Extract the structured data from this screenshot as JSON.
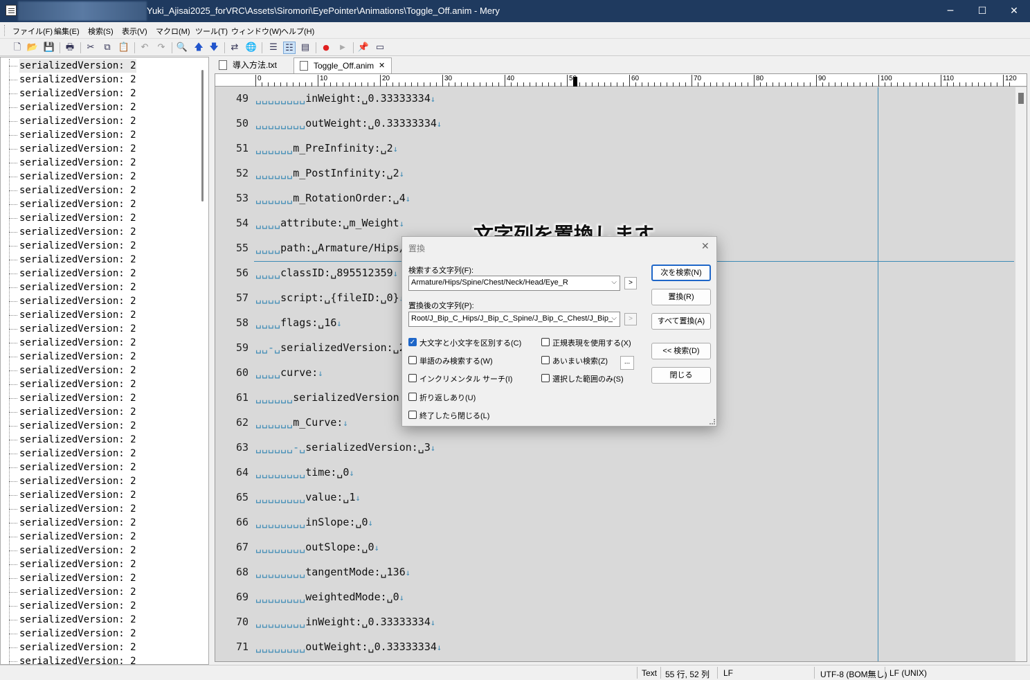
{
  "window": {
    "title": "Yuki_Ajisai2025_forVRC\\Assets\\Siromori\\EyePointer\\Animations\\Toggle_Off.anim - Mery",
    "minimize": "─",
    "maximize": "☐",
    "close": "✕"
  },
  "menu": [
    "ファイル(F)",
    "編集(E)",
    "検索(S)",
    "表示(V)",
    "マクロ(M)",
    "ツール(T)",
    "ウィンドウ(W)",
    "ヘルプ(H)"
  ],
  "toolbar": {
    "icons": [
      "new-file-icon",
      "open-folder-icon",
      "save-icon",
      "print-icon",
      "cut-icon",
      "copy-icon",
      "paste-icon",
      "undo-icon",
      "redo-icon",
      "find-icon",
      "find-prev-icon",
      "find-next-icon",
      "replace-icon",
      "web-icon",
      "wrap-none-icon",
      "wrap-window-icon",
      "wrap-column-icon",
      "record-macro-icon",
      "run-macro-icon",
      "pin-icon",
      "window-icon"
    ],
    "glyphs": {
      "new": "🗋",
      "open": "📂",
      "save": "💾",
      "print": "🖶",
      "cut": "✂",
      "copy": "⧉",
      "paste": "📋",
      "undo": "↶",
      "redo": "↷",
      "find": "🔍",
      "up": "🡅",
      "down": "🡇",
      "replace": "⇄",
      "web": "🌐",
      "wrap1": "☰",
      "wrap2": "☷",
      "wrap3": "▤",
      "rec": "●",
      "play": "▶",
      "pin": "📌",
      "win": "▭"
    },
    "colors": {
      "record": "#e02020"
    }
  },
  "outline": {
    "item_label": "serializedVersion: 2",
    "rows": 44
  },
  "tabs": [
    {
      "label": "導入方法.txt",
      "active": false
    },
    {
      "label": "Toggle_Off.anim",
      "active": true,
      "close": "✕"
    }
  ],
  "ruler": [
    "0",
    "10",
    "20",
    "30",
    "40",
    "50",
    "60",
    "70",
    "80",
    "90",
    "100",
    "110",
    "120"
  ],
  "editor": {
    "lines": [
      {
        "n": "49",
        "ind": "␣␣␣␣␣␣␣␣",
        "text": "inWeight:␣0.33333334"
      },
      {
        "n": "50",
        "ind": "␣␣␣␣␣␣␣␣",
        "text": "outWeight:␣0.33333334"
      },
      {
        "n": "51",
        "ind": "␣␣␣␣␣␣",
        "text": "m_PreInfinity:␣2"
      },
      {
        "n": "52",
        "ind": "␣␣␣␣␣␣",
        "text": "m_PostInfinity:␣2"
      },
      {
        "n": "53",
        "ind": "␣␣␣␣␣␣",
        "text": "m_RotationOrder:␣4"
      },
      {
        "n": "54",
        "ind": "␣␣␣␣",
        "text": "attribute:␣m_Weight"
      },
      {
        "n": "55",
        "ind": "␣␣␣␣",
        "text": "path:␣Armature/Hips/"
      },
      {
        "n": "56",
        "ind": "␣␣␣␣",
        "text": "classID:␣895512359"
      },
      {
        "n": "57",
        "ind": "␣␣␣␣",
        "text": "script:␣{fileID:␣0}"
      },
      {
        "n": "58",
        "ind": "␣␣␣␣",
        "text": "flags:␣16"
      },
      {
        "n": "59",
        "ind": "␣␣-␣",
        "text": "serializedVersion:␣2"
      },
      {
        "n": "60",
        "ind": "␣␣␣␣",
        "text": "curve:"
      },
      {
        "n": "61",
        "ind": "␣␣␣␣␣␣",
        "text": "serializedVersion:"
      },
      {
        "n": "62",
        "ind": "␣␣␣␣␣␣",
        "text": "m_Curve:"
      },
      {
        "n": "63",
        "ind": "␣␣␣␣␣␣-␣",
        "text": "serializedVersion:␣3"
      },
      {
        "n": "64",
        "ind": "␣␣␣␣␣␣␣␣",
        "text": "time:␣0"
      },
      {
        "n": "65",
        "ind": "␣␣␣␣␣␣␣␣",
        "text": "value:␣1"
      },
      {
        "n": "66",
        "ind": "␣␣␣␣␣␣␣␣",
        "text": "inSlope:␣0"
      },
      {
        "n": "67",
        "ind": "␣␣␣␣␣␣␣␣",
        "text": "outSlope:␣0"
      },
      {
        "n": "68",
        "ind": "␣␣␣␣␣␣␣␣",
        "text": "tangentMode:␣136"
      },
      {
        "n": "69",
        "ind": "␣␣␣␣␣␣␣␣",
        "text": "weightedMode:␣0"
      },
      {
        "n": "70",
        "ind": "␣␣␣␣␣␣␣␣",
        "text": "inWeight:␣0.33333334"
      },
      {
        "n": "71",
        "ind": "␣␣␣␣␣␣␣␣",
        "text": "outWeight:␣0.33333334"
      }
    ],
    "eol": "↓"
  },
  "caption": "文字列を置換します",
  "dialog": {
    "title": "置換",
    "close": "✕",
    "find_label": "検索する文字列(F):",
    "find_value": "Armature/Hips/Spine/Chest/Neck/Head/Eye_R",
    "replace_label": "置換後の文字列(P):",
    "replace_value": "Root/J_Bip_C_Hips/J_Bip_C_Spine/J_Bip_C_Chest/J_Bip_",
    "arrow": ">",
    "dropdown": "⌵",
    "checks": {
      "match_case": {
        "label": "大文字と小文字を区別する(C)",
        "checked": true
      },
      "regex": {
        "label": "正規表現を使用する(X)",
        "checked": false
      },
      "whole_word": {
        "label": "単語のみ検索する(W)",
        "checked": false
      },
      "fuzzy": {
        "label": "あいまい検索(Z)",
        "checked": false
      },
      "incremental": {
        "label": "インクリメンタル サーチ(I)",
        "checked": false
      },
      "selection": {
        "label": "選択した範囲のみ(S)",
        "checked": false
      },
      "wrap": {
        "label": "折り返しあり(U)",
        "checked": false
      },
      "close_on_done": {
        "label": "終了したら閉じる(L)",
        "checked": false
      }
    },
    "ellipsis": "...",
    "check_mark": "✓",
    "buttons": {
      "find_next": "次を検索(N)",
      "replace": "置換(R)",
      "replace_all": "すべて置換(A)",
      "find_prev": "<< 検索(D)",
      "close": "閉じる"
    }
  },
  "status": {
    "mode": "Text",
    "position": "55 行, 52 列",
    "eol_type": "LF",
    "encoding": "UTF-8 (BOM無し)",
    "newline": "LF (UNIX)"
  },
  "colors": {
    "title_bar": "#1f3a5f",
    "accent": "#1e66c8",
    "whitespace_marks": "#3c8ab5"
  }
}
